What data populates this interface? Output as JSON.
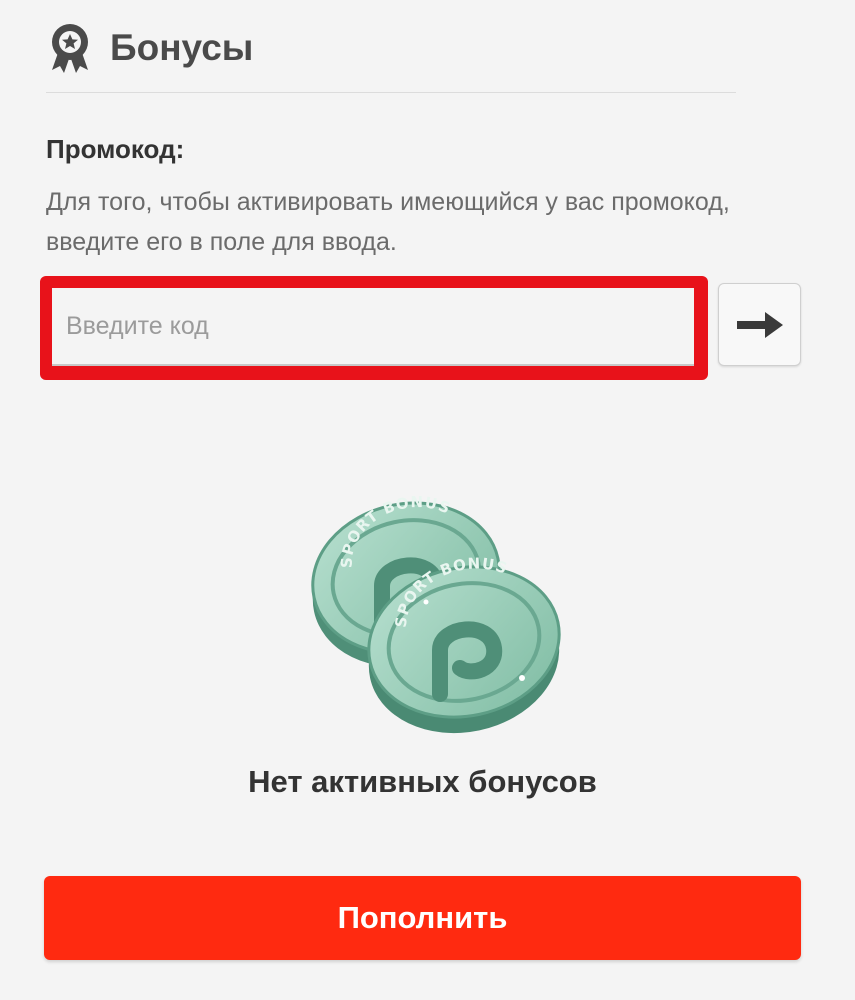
{
  "header": {
    "title": "Бонусы",
    "icon": "award-ribbon-icon"
  },
  "promo": {
    "label": "Промокод:",
    "description": "Для того, чтобы активировать имеющийся у вас промокод, введите его в поле для ввода.",
    "input_placeholder": "Введите код",
    "input_value": "",
    "submit_icon": "arrow-right-icon"
  },
  "bonuses": {
    "image": "sport-bonus-coins",
    "coin_text": "SPORT BONUS",
    "empty_message": "Нет активных бонусов"
  },
  "actions": {
    "deposit_label": "Пополнить"
  },
  "colors": {
    "accent": "#ff2a10",
    "highlight": "#e8121a",
    "background": "#f4f4f4",
    "coin": "#8fc9b2"
  }
}
